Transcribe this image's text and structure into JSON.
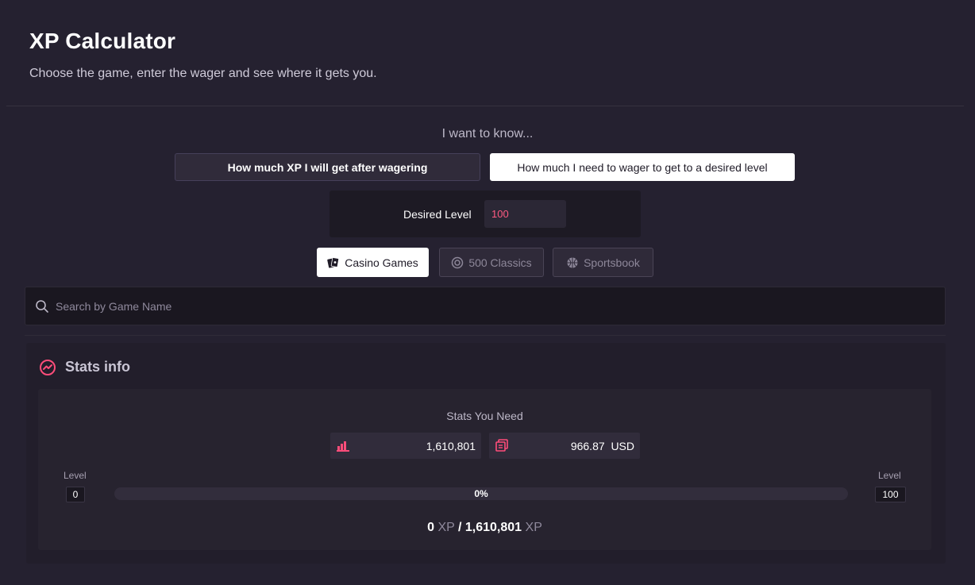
{
  "header": {
    "title": "XP Calculator",
    "subtitle": "Choose the game, enter the wager and see where it gets you."
  },
  "mode": {
    "prompt": "I want to know...",
    "option_xp": "How much XP I will get after wagering",
    "option_wager": "How much I need to wager to get to a desired level",
    "selected": "option_wager"
  },
  "level_input": {
    "label": "Desired Level",
    "value": "100"
  },
  "categories": {
    "casino": "Casino Games",
    "classics": "500 Classics",
    "sportsbook": "Sportsbook",
    "selected": "casino"
  },
  "search": {
    "placeholder": "Search by Game Name",
    "value": ""
  },
  "stats": {
    "title": "Stats info",
    "need_label": "Stats You Need",
    "xp_needed": "1,610,801",
    "usd_needed": "966.87",
    "usd_unit": "USD",
    "level_caption": "Level",
    "level_start": "0",
    "level_end": "100",
    "progress": 0,
    "progress_text": "0%",
    "current_xp": "0",
    "total_xp": "1,610,801",
    "xp_unit": "XP",
    "separator": "/"
  },
  "colors": {
    "accent": "#ff4d7a",
    "background": "#252130",
    "panel": "#221e2b"
  },
  "icons": {
    "casino": "cards-icon",
    "classics": "classics-icon",
    "sportsbook": "basketball-icon",
    "search": "search-icon",
    "stats": "trend-icon",
    "xp": "bar-chart-icon",
    "usd": "cash-icon"
  }
}
